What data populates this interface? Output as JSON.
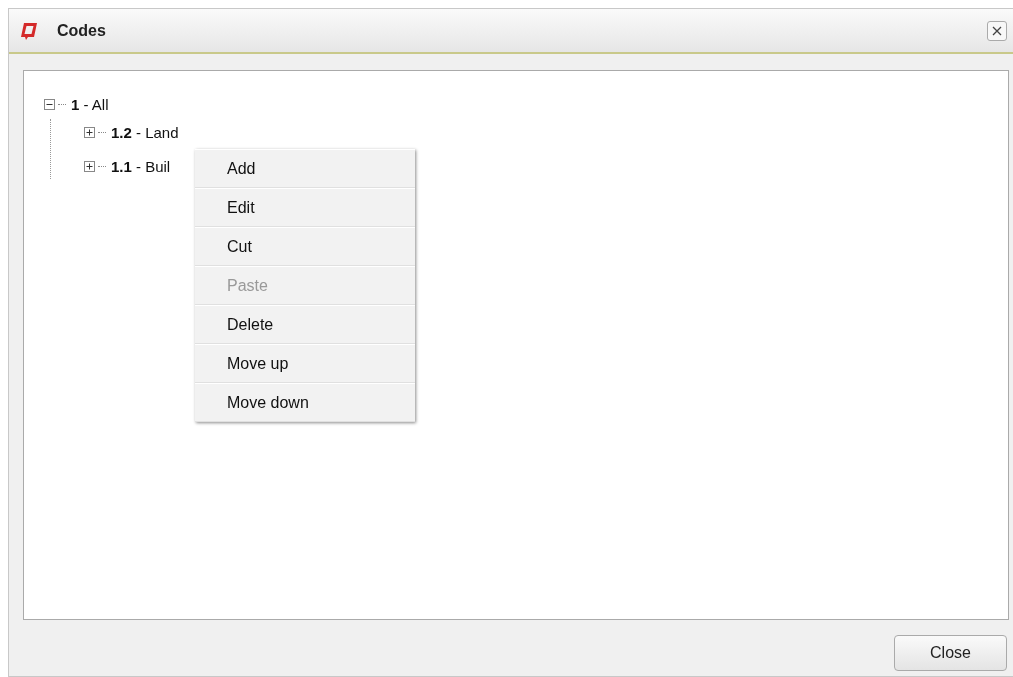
{
  "window": {
    "title": "Codes"
  },
  "tree": [
    {
      "label": "**1** - All",
      "expanded": true,
      "children": [
        {
          "label": "**1.2** - Land",
          "expanded": false
        },
        {
          "label": "**1.1** - Buil",
          "expanded": false
        }
      ]
    }
  ],
  "context_menu": [
    {
      "label": "Add",
      "disabled": false
    },
    {
      "label": "Edit",
      "disabled": false
    },
    {
      "label": "Cut",
      "disabled": false
    },
    {
      "label": "Paste",
      "disabled": true
    },
    {
      "label": "Delete",
      "disabled": false
    },
    {
      "label": "Move up",
      "disabled": false
    },
    {
      "label": "Move down",
      "disabled": false
    }
  ],
  "buttons": [
    {
      "label": "Close"
    }
  ]
}
